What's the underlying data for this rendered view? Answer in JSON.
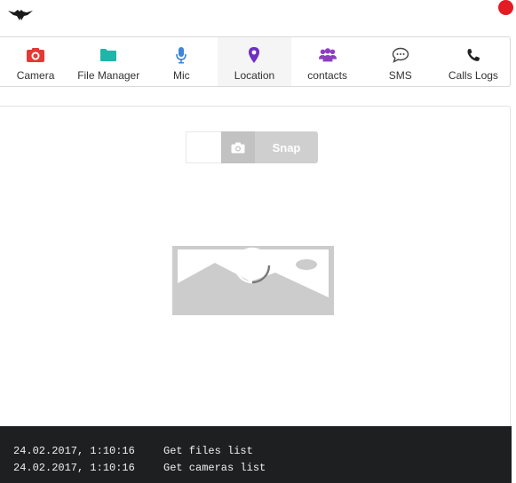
{
  "header": {
    "logo_icon": "raven-logo-icon",
    "status_color": "#e31b23"
  },
  "tabs": [
    {
      "label": "Camera",
      "icon": "camera-icon",
      "color": "#e53935"
    },
    {
      "label": "File Manager",
      "icon": "folder-icon",
      "color": "#1fb5a8"
    },
    {
      "label": "Mic",
      "icon": "microphone-icon",
      "color": "#3f86d6"
    },
    {
      "label": "Location",
      "icon": "map-pin-icon",
      "color": "#6f2fc4",
      "active": true
    },
    {
      "label": "contacts",
      "icon": "users-icon",
      "color": "#8e3fbf"
    },
    {
      "label": "SMS",
      "icon": "chat-bubble-icon",
      "color": "#444444"
    },
    {
      "label": "Calls Logs",
      "icon": "phone-icon",
      "color": "#222222"
    }
  ],
  "camera_panel": {
    "snap_label": "Snap",
    "snap_icon": "camera-icon",
    "preview_icon": "image-placeholder-icon"
  },
  "console": {
    "logs": [
      {
        "time": "24.02.2017, 1:10:16",
        "message": "Get files list"
      },
      {
        "time": "24.02.2017, 1:10:16",
        "message": "Get cameras list"
      }
    ]
  }
}
